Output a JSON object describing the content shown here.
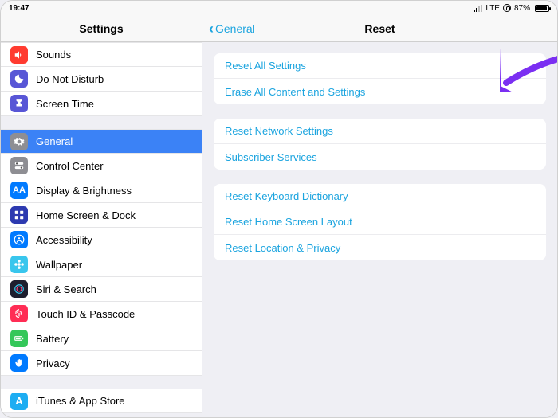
{
  "status": {
    "time": "19:47",
    "carrier": "LTE",
    "battery_pct": "87%",
    "battery_fill_pct": 87
  },
  "sidebar": {
    "title": "Settings",
    "groups": [
      {
        "items": [
          {
            "key": "sounds",
            "label": "Sounds",
            "icon_bg": "#ff3b30",
            "icon": "volume"
          },
          {
            "key": "dnd",
            "label": "Do Not Disturb",
            "icon_bg": "#5856d6",
            "icon": "moon"
          },
          {
            "key": "screentime",
            "label": "Screen Time",
            "icon_bg": "#5856d6",
            "icon": "hourglass"
          }
        ]
      },
      {
        "items": [
          {
            "key": "general",
            "label": "General",
            "icon_bg": "#8e8e93",
            "icon": "gear",
            "selected": true
          },
          {
            "key": "controlcenter",
            "label": "Control Center",
            "icon_bg": "#8e8e93",
            "icon": "switches"
          },
          {
            "key": "display",
            "label": "Display & Brightness",
            "icon_bg": "#007aff",
            "icon": "AA"
          },
          {
            "key": "homescreen",
            "label": "Home Screen & Dock",
            "icon_bg": "#2d3ab0",
            "icon": "grid"
          },
          {
            "key": "accessibility",
            "label": "Accessibility",
            "icon_bg": "#007aff",
            "icon": "person"
          },
          {
            "key": "wallpaper",
            "label": "Wallpaper",
            "icon_bg": "#39c6ed",
            "icon": "flower"
          },
          {
            "key": "siri",
            "label": "Siri & Search",
            "icon_bg": "#1e1e2e",
            "icon": "siri"
          },
          {
            "key": "touchid",
            "label": "Touch ID & Passcode",
            "icon_bg": "#ff2d55",
            "icon": "finger"
          },
          {
            "key": "battery",
            "label": "Battery",
            "icon_bg": "#34c759",
            "icon": "battery"
          },
          {
            "key": "privacy",
            "label": "Privacy",
            "icon_bg": "#007aff",
            "icon": "hand"
          }
        ]
      },
      {
        "items": [
          {
            "key": "itunes",
            "label": "iTunes & App Store",
            "icon_bg": "#1dadf2",
            "icon": "A"
          }
        ]
      }
    ]
  },
  "detail": {
    "back_label": "General",
    "title": "Reset",
    "sections": [
      {
        "items": [
          {
            "key": "reset-all",
            "label": "Reset All Settings"
          },
          {
            "key": "erase-all",
            "label": "Erase All Content and Settings"
          }
        ]
      },
      {
        "items": [
          {
            "key": "reset-network",
            "label": "Reset Network Settings"
          },
          {
            "key": "subscriber",
            "label": "Subscriber Services"
          }
        ]
      },
      {
        "items": [
          {
            "key": "reset-keyboard",
            "label": "Reset Keyboard Dictionary"
          },
          {
            "key": "reset-home",
            "label": "Reset Home Screen Layout"
          },
          {
            "key": "reset-location",
            "label": "Reset Location & Privacy"
          }
        ]
      }
    ]
  },
  "annotation": {
    "arrow_target": "reset-all",
    "arrow_color": "#7b2ff2"
  }
}
